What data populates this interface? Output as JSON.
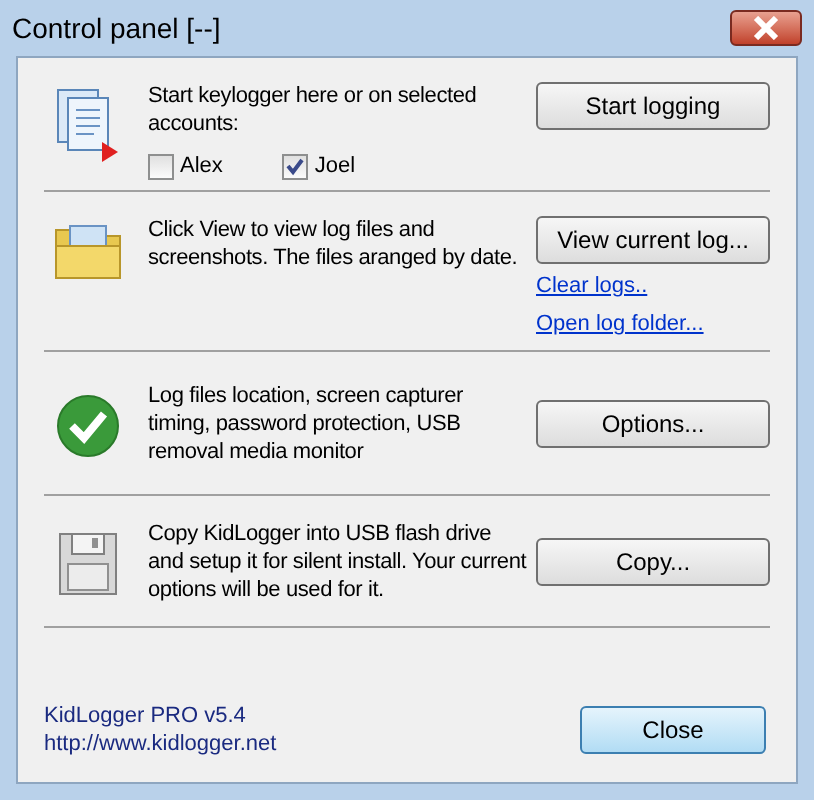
{
  "window": {
    "title": "Control panel  [--]"
  },
  "sections": [
    {
      "text": "Start keylogger here or on selected accounts:",
      "button": "Start logging",
      "accounts": [
        {
          "label": "Alex",
          "checked": false
        },
        {
          "label": "Joel",
          "checked": true
        }
      ]
    },
    {
      "text": "Click View to view log files and screenshots. The files aranged by date.",
      "button": "View current log...",
      "links": [
        "Clear logs..",
        "Open log folder..."
      ]
    },
    {
      "text": "Log files location, screen capturer timing, password protection, USB removal media monitor",
      "button": "Options..."
    },
    {
      "text": "Copy KidLogger into USB flash drive and setup it for silent install. Your current options will be used for it.",
      "button": "Copy..."
    }
  ],
  "footer": {
    "product": "KidLogger PRO v5.4",
    "url": "http://www.kidlogger.net",
    "button": "Close"
  }
}
